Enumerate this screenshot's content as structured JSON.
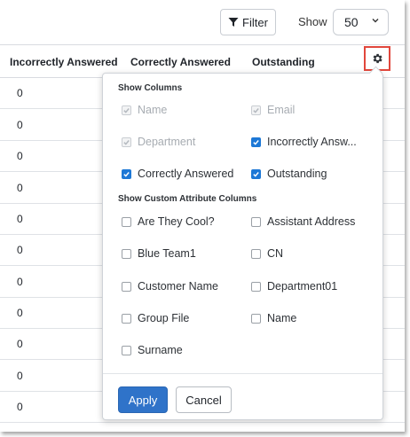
{
  "toolbar": {
    "filter_label": "Filter",
    "show_label": "Show",
    "page_size": "50"
  },
  "columns": {
    "incorrect": "Incorrectly Answered",
    "correct": "Correctly Answered",
    "outstanding": "Outstanding"
  },
  "rows": [
    "0",
    "0",
    "0",
    "0",
    "0",
    "0",
    "0",
    "0",
    "0",
    "0",
    "0"
  ],
  "popup": {
    "show_columns_title": "Show Columns",
    "show_columns": [
      {
        "label": "Name",
        "checked": true,
        "disabled": true
      },
      {
        "label": "Email",
        "checked": true,
        "disabled": true
      },
      {
        "label": "Department",
        "checked": true,
        "disabled": true
      },
      {
        "label": "Incorrectly Answ...",
        "checked": true,
        "disabled": false
      },
      {
        "label": "Correctly Answered",
        "checked": true,
        "disabled": false
      },
      {
        "label": "Outstanding",
        "checked": true,
        "disabled": false
      }
    ],
    "custom_title": "Show Custom Attribute Columns",
    "custom_columns": [
      {
        "label": "Are They Cool?",
        "checked": false
      },
      {
        "label": "Assistant Address",
        "checked": false
      },
      {
        "label": "Blue Team1",
        "checked": false
      },
      {
        "label": "CN",
        "checked": false
      },
      {
        "label": "Customer Name",
        "checked": false
      },
      {
        "label": "Department01",
        "checked": false
      },
      {
        "label": "Group File",
        "checked": false
      },
      {
        "label": "Name",
        "checked": false
      },
      {
        "label": "Surname",
        "checked": false
      }
    ],
    "apply_label": "Apply",
    "cancel_label": "Cancel"
  },
  "colors": {
    "accent": "#1d78d6",
    "apply_bg": "#2f73c9",
    "highlight_border": "#e1473c"
  }
}
